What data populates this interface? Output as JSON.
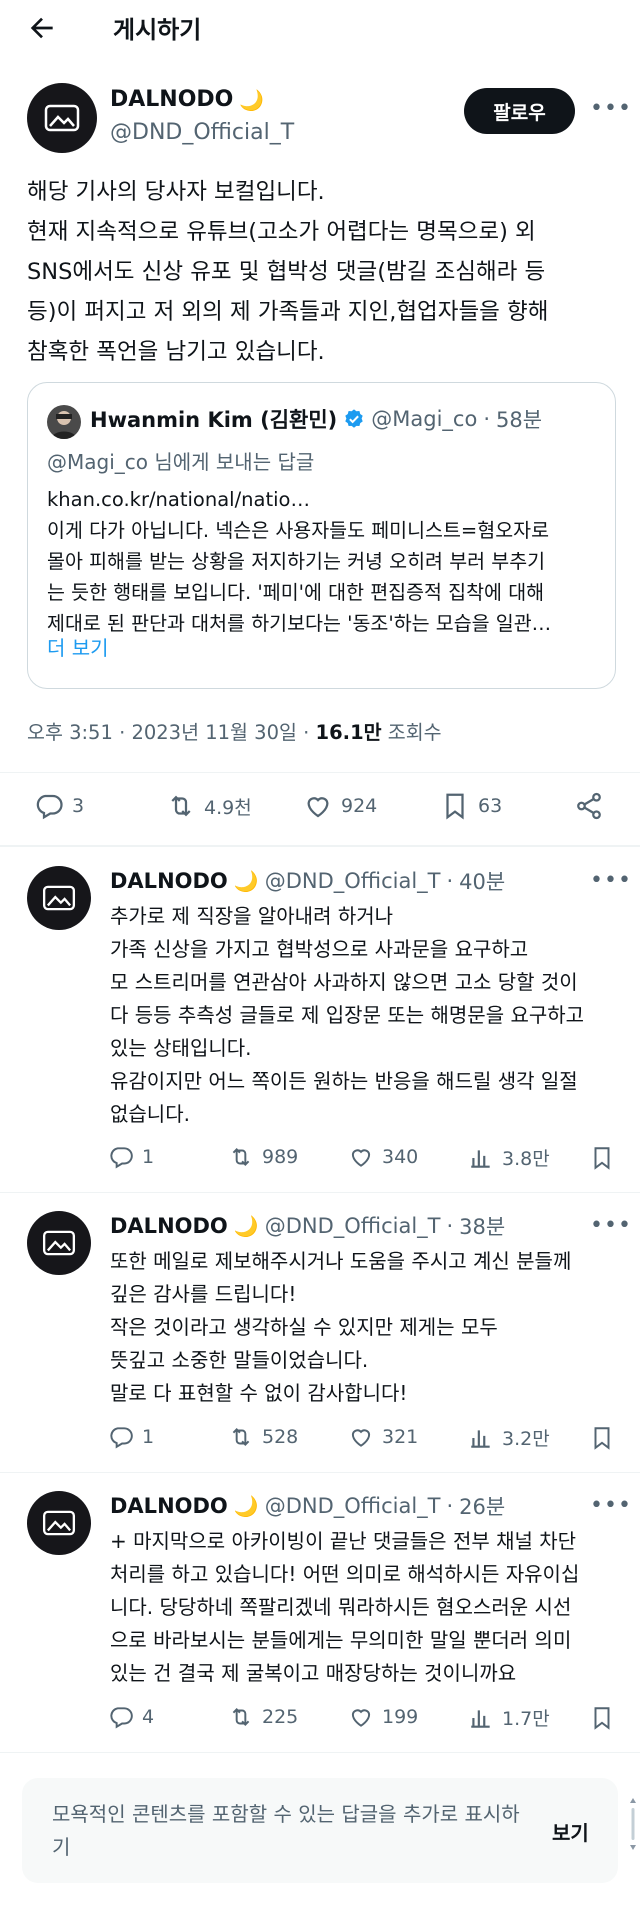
{
  "header": {
    "title": "게시하기"
  },
  "main_post": {
    "author": {
      "name": "DALNODO",
      "handle": "@DND_Official_T"
    },
    "follow_label": "팔로우",
    "text_lines": [
      "해당 기사의 당사자 보컬입니다.",
      "현재 지속적으로 유튜브(고소가 어렵다는 명목으로) 외",
      "SNS에서도 신상 유포 및 협박성 댓글(밤길 조심해라 등",
      "등)이 퍼지고 저 외의 제 가족들과 지인,협업자들을 향해",
      "참혹한 폭언을 남기고 있습니다."
    ],
    "quote": {
      "name": "Hwanmin Kim (김환민)",
      "handle": "@Magi_co",
      "time": "58분",
      "reply_to": "@Magi_co 님에게 보내는 답글",
      "lines": [
        "khan.co.kr/national/natio…",
        "이게 다가 아닙니다. 넥슨은 사용자들도 페미니스트=혐오자로",
        "몰아 피해를 받는 상황을 저지하기는 커녕 오히려 부러 부추기",
        "는 듯한 행태를 보입니다. '페미'에 대한 편집증적 집착에 대해",
        "제대로 된 판단과 대처를 하기보다는 '동조'하는 모습을 일관…"
      ],
      "more_label": "더 보기"
    },
    "timestamp": "오후 3:51 · 2023년 11월 30일 · ",
    "views": "16.1만",
    "views_label": " 조회수",
    "stats": {
      "replies": "3",
      "retweets": "4.9천",
      "likes": "924",
      "bookmarks": "63"
    }
  },
  "replies": [
    {
      "name": "DALNODO",
      "handle": "@DND_Official_T",
      "time": "40분",
      "lines": [
        "추가로 제 직장을 알아내려 하거나",
        "가족 신상을 가지고 협박성으로 사과문을 요구하고",
        "모 스트리머를 연관삼아 사과하지 않으면 고소 당할 것이",
        "다 등등 추측성 글들로 제 입장문 또는 해명문을 요구하고",
        "있는 상태입니다.",
        "유감이지만 어느 쪽이든 원하는 반응을 해드릴 생각 일절",
        "없습니다."
      ],
      "stats": {
        "replies": "1",
        "retweets": "989",
        "likes": "340",
        "views": "3.8만"
      }
    },
    {
      "name": "DALNODO",
      "handle": "@DND_Official_T",
      "time": "38분",
      "lines": [
        "또한 메일로 제보해주시거나 도움을 주시고 계신 분들께",
        "깊은 감사를 드립니다!",
        "작은 것이라고 생각하실 수 있지만 제게는 모두",
        "뜻깊고 소중한 말들이었습니다.",
        "말로 다 표현할 수 없이 감사합니다!"
      ],
      "stats": {
        "replies": "1",
        "retweets": "528",
        "likes": "321",
        "views": "3.2만"
      }
    },
    {
      "name": "DALNODO",
      "handle": "@DND_Official_T",
      "time": "26분",
      "lines": [
        "+ 마지막으로 아카이빙이 끝난 댓글들은 전부 채널 차단",
        "처리를 하고 있습니다! 어떤 의미로 해석하시든 자유이십",
        "니다. 당당하네 쪽팔리겠네 뭐라하시든 혐오스러운 시선",
        "으로 바라보시는 분들에게는 무의미한 말일 뿐더러 의미",
        "있는 건 결국 제 굴복이고 매장당하는 것이니까요"
      ],
      "stats": {
        "replies": "4",
        "retweets": "225",
        "likes": "199",
        "views": "1.7만"
      }
    }
  ],
  "notice": {
    "text": "모욕적인 콘텐츠를 포함할 수 있는 답글을 추가로 표시하기",
    "button": "보기"
  },
  "icons": {
    "back": "arrow-left-icon",
    "more": "more-dots-icon",
    "moon": "crescent-moon-icon",
    "verified": "verified-badge-icon",
    "reply": "reply-bubble-icon",
    "retweet": "retweet-icon",
    "like": "heart-icon",
    "bookmark": "bookmark-icon",
    "share": "share-icon",
    "views": "bar-chart-icon"
  },
  "colors": {
    "accent": "#1d9bf0",
    "muted": "#536471",
    "text": "#0f1419",
    "moon": "#f4c542"
  }
}
